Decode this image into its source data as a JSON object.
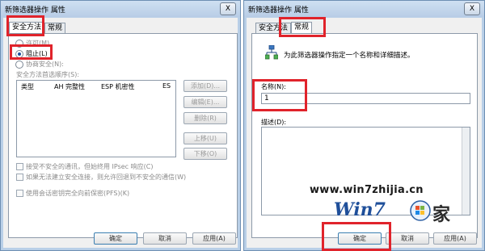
{
  "left_dialog": {
    "title": "新筛选器操作 属性",
    "close": "X",
    "tabs": [
      "安全方法",
      "常规"
    ],
    "radios": [
      "许可(M)",
      "阻止(L)",
      "协商安全(N):"
    ],
    "list_label": "安全方法首选顺序(S):",
    "columns": [
      "类型",
      "AH 完整性",
      "ESP 机密性",
      "ES"
    ],
    "side_buttons": [
      "添加(D)...",
      "编辑(E)...",
      "删除(R)",
      "上移(U)",
      "下移(O)"
    ],
    "checks": [
      "接受不安全的通讯，但始终用 IPsec 响应(C)",
      "如果无法建立安全连接，则允许回退到不安全的通信(W)",
      "使用会话密钥完全向前保密(PFS)(K)"
    ],
    "buttons": [
      "确定",
      "取消",
      "应用(A)"
    ]
  },
  "right_dialog": {
    "title": "新筛选器操作 属性",
    "close": "X",
    "tabs": [
      "安全方法",
      "常规"
    ],
    "description_text": "为此筛选器操作指定一个名称和详细描述。",
    "name_label": "名称(N):",
    "name_value": "1",
    "desc_label": "描述(D):",
    "buttons": [
      "确定",
      "取消",
      "应用(A)"
    ]
  },
  "watermark": {
    "url": "www.win7zhijia.cn",
    "logo": "Win7",
    "logo_suffix": "家"
  },
  "colors": {
    "highlight": "#e0232b",
    "titlebar": "#b9cfe7"
  }
}
